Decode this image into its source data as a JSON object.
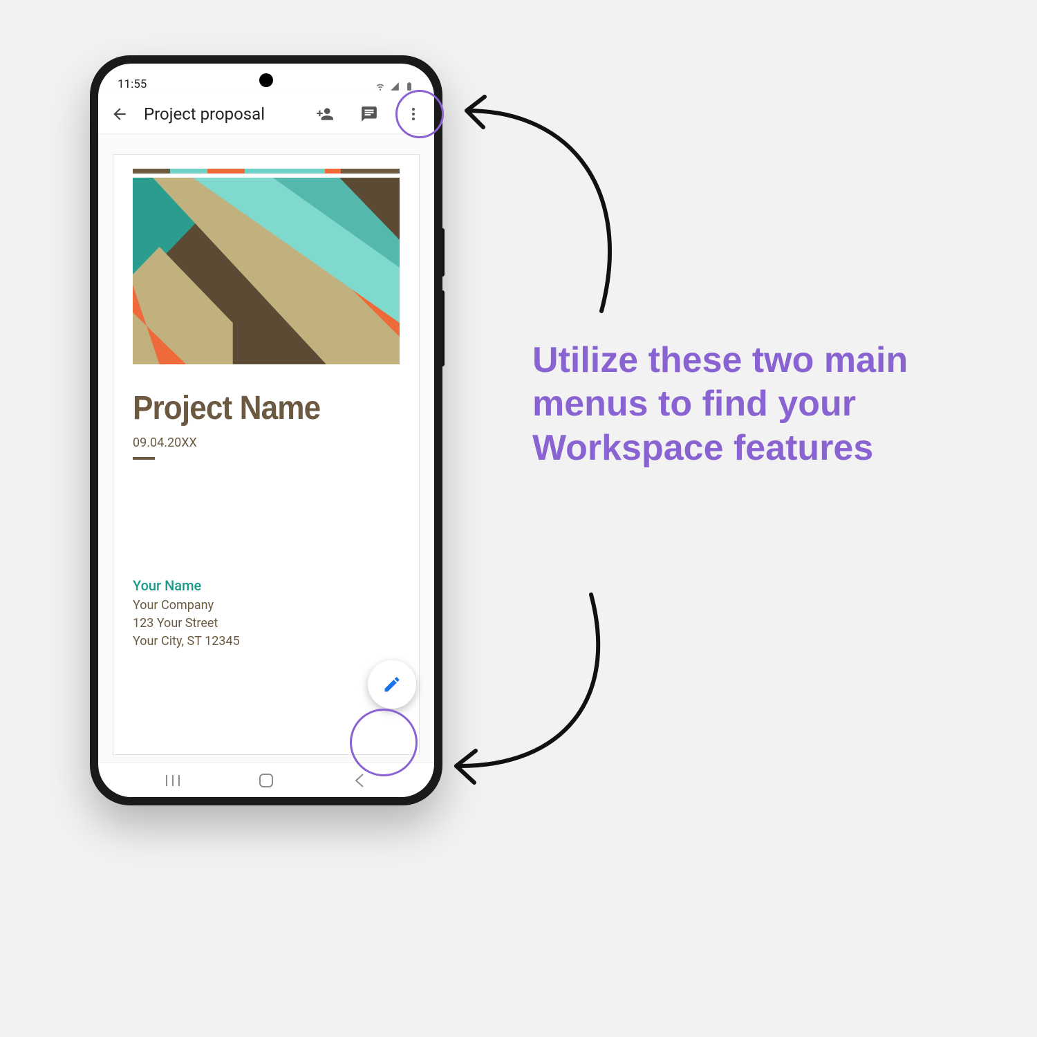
{
  "status": {
    "time": "11:55"
  },
  "appbar": {
    "title": "Project proposal"
  },
  "icons": {
    "back": "back-arrow-icon",
    "add_person": "add-person-icon",
    "comment": "comment-icon",
    "more": "more-vertical-icon",
    "edit_fab": "pencil-icon",
    "nav_recents": "nav-recents-icon",
    "nav_home": "nav-home-icon",
    "nav_back": "nav-back-icon"
  },
  "accent_colors": [
    {
      "c": "#6b5a41",
      "w": 14
    },
    {
      "c": "#6fd1c6",
      "w": 14
    },
    {
      "c": "#ee6a3a",
      "w": 14
    },
    {
      "c": "#6fd1c6",
      "w": 30
    },
    {
      "c": "#ee6a3a",
      "w": 6
    },
    {
      "c": "#6b5a41",
      "w": 22
    }
  ],
  "doc": {
    "title": "Project Name",
    "date": "09.04.20XX",
    "contact": {
      "name": "Your Name",
      "company": "Your Company",
      "street": "123 Your Street",
      "city": "Your City, ST 12345"
    }
  },
  "annotation": "Utilize these two main menus to find your Workspace features",
  "colors": {
    "highlight": "#8a63d2",
    "fab_icon": "#1a73e8"
  }
}
